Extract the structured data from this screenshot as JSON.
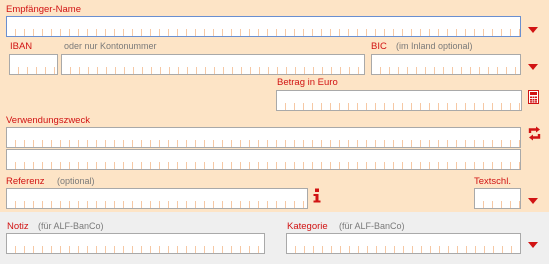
{
  "recipient": {
    "label": "Empfänger-Name"
  },
  "iban": {
    "label": "IBAN",
    "hint": "oder nur Kontonummer"
  },
  "bic": {
    "label": "BIC",
    "hint": "(im Inland optional)"
  },
  "amount": {
    "label": "Betrag in Euro"
  },
  "purpose": {
    "label": "Verwendungszweck"
  },
  "reference": {
    "label": "Referenz",
    "hint": "(optional)"
  },
  "text_key": {
    "label": "Textschl."
  },
  "note": {
    "label": "Notiz",
    "hint": "(für ALF-BanCo)"
  },
  "category": {
    "label": "Kategorie",
    "hint": "(für ALF-BanCo)"
  },
  "icons": {
    "dropdown": "triangle-down-icon",
    "calculator": "calculator-icon",
    "swap": "swap-icon",
    "info": "info-icon"
  },
  "colors": {
    "label": "#d11313",
    "background": "#fde4c6",
    "accent_border": "#6a8fd0"
  }
}
